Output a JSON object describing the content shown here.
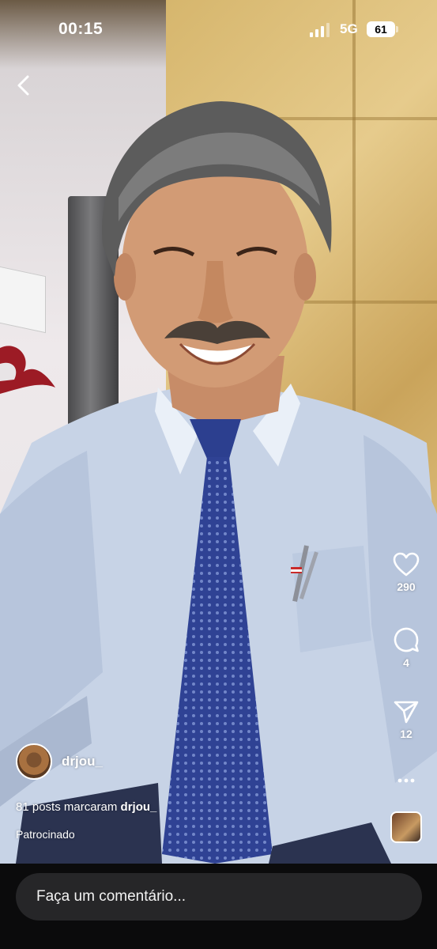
{
  "status_bar": {
    "time": "00:15",
    "network": "5G",
    "battery": "61"
  },
  "post": {
    "username": "drjou_",
    "tagged_prefix": "81 posts marcaram ",
    "tagged_user": "drjou_",
    "sponsored_label": "Patrocinado"
  },
  "actions": {
    "likes": "290",
    "comments": "4",
    "shares": "12"
  },
  "comment_bar": {
    "placeholder": "Faça um comentário..."
  },
  "icons": {
    "back": "chevron-left-icon",
    "like": "heart-icon",
    "comment": "comment-bubble-icon",
    "share": "paper-plane-icon",
    "more": "more-dots-icon"
  }
}
